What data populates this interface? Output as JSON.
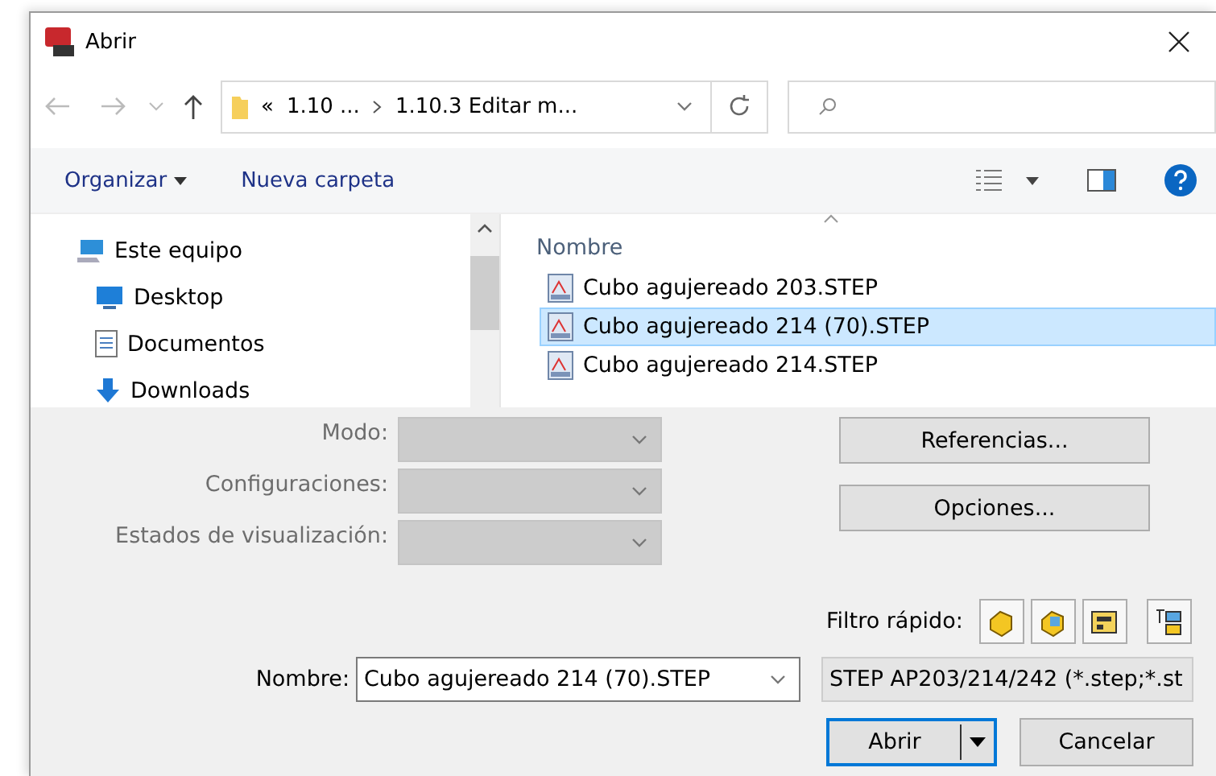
{
  "window": {
    "title": "Abrir"
  },
  "address": {
    "overflow": "«",
    "crumbs": [
      "1.10 ...",
      "1.10.3 Editar m..."
    ]
  },
  "toolbar": {
    "organize": "Organizar",
    "new_folder": "Nueva carpeta"
  },
  "sidebar": {
    "items": [
      {
        "label": "Este equipo",
        "kind": "computer"
      },
      {
        "label": "Desktop",
        "kind": "desktop"
      },
      {
        "label": "Documentos",
        "kind": "documents"
      },
      {
        "label": "Downloads",
        "kind": "downloads"
      }
    ]
  },
  "file_list": {
    "column": "Nombre",
    "rows": [
      {
        "name": "Cubo agujereado 203.STEP",
        "selected": false
      },
      {
        "name": "Cubo agujereado 214 (70).STEP",
        "selected": true
      },
      {
        "name": "Cubo agujereado 214.STEP",
        "selected": false
      }
    ]
  },
  "options": [
    {
      "label": "Modo:",
      "disabled": true
    },
    {
      "label": "Configuraciones:",
      "disabled": true
    },
    {
      "label": "Estados de visualización:",
      "disabled": true
    }
  ],
  "side_buttons": [
    "Referencias...",
    "Opciones..."
  ],
  "quick_filter": {
    "label": "Filtro rápido:"
  },
  "file_name": {
    "label": "Nombre:",
    "value": "Cubo agujereado 214 (70).STEP"
  },
  "file_type": {
    "value": "STEP AP203/214/242 (*.step;*.st"
  },
  "buttons": [
    {
      "label": "Abrir",
      "default": true,
      "split": true
    },
    {
      "label": "Cancelar",
      "default": false,
      "split": false
    }
  ]
}
